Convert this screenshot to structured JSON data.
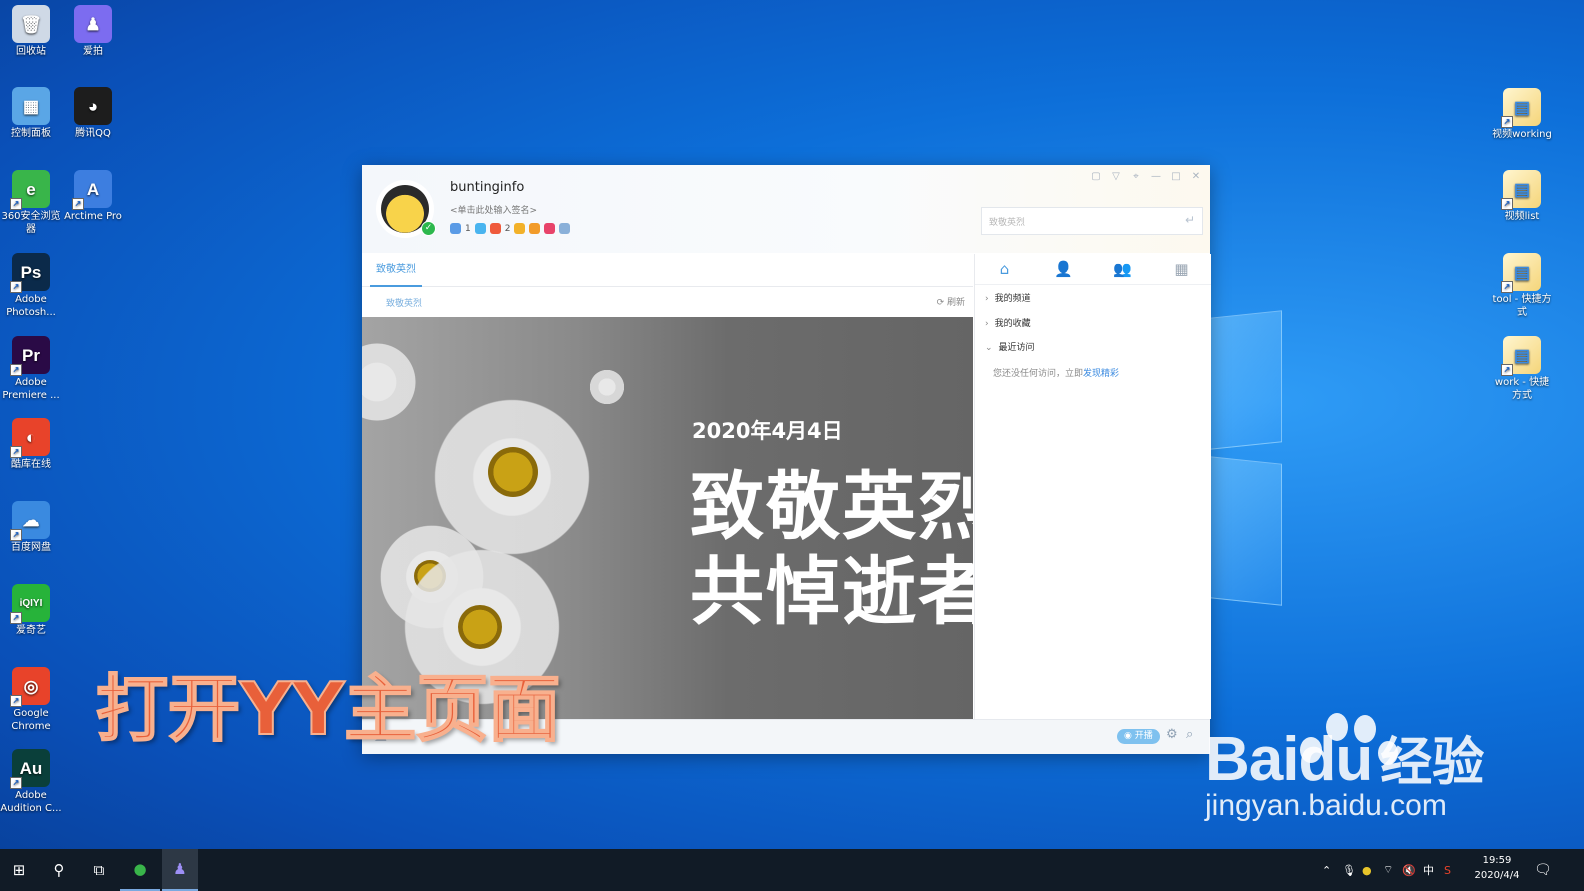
{
  "desktop": {
    "left_icons": [
      {
        "label": "回收站",
        "icon": "recycle-bin-icon",
        "glyph": "🗑",
        "color": "#cfd9e6"
      },
      {
        "label": "爱拍",
        "icon": "aipai-icon",
        "glyph": "♟",
        "color": "#7c6cf0"
      },
      {
        "label": "控制面板",
        "icon": "control-panel-icon",
        "glyph": "▦",
        "color": "#5aa6e6"
      },
      {
        "label": "腾讯QQ",
        "icon": "qq-icon",
        "glyph": "◕",
        "color": "#1d1d1d"
      },
      {
        "label": "360安全浏览器",
        "icon": "browser-360-icon",
        "glyph": "e",
        "color": "#39b54a"
      },
      {
        "label": "Arctime Pro",
        "icon": "arctime-icon",
        "glyph": "A",
        "color": "#3d7ee0"
      },
      {
        "label": "Adobe Photosh...",
        "icon": "photoshop-icon",
        "glyph": "Ps",
        "color": "#0b2a4a"
      },
      {
        "label": "Adobe Premiere ...",
        "icon": "premiere-icon",
        "glyph": "Pr",
        "color": "#2a0a46"
      },
      {
        "label": "酷库在线",
        "icon": "kuku-icon",
        "glyph": "◐",
        "color": "#e8432a"
      },
      {
        "label": "百度网盘",
        "icon": "baidu-netdisk-icon",
        "glyph": "☁",
        "color": "#3a8ae0"
      },
      {
        "label": "爱奇艺",
        "icon": "iqiyi-icon",
        "glyph": "iQIYI",
        "color": "#27b33a"
      },
      {
        "label": "Google Chrome",
        "icon": "chrome-icon",
        "glyph": "◎",
        "color": "#e8432a"
      },
      {
        "label": "Adobe Audition C...",
        "icon": "audition-icon",
        "glyph": "Au",
        "color": "#0a3f3a"
      }
    ],
    "right_icons": [
      {
        "label": "视频working",
        "icon": "folder-shortcut-icon"
      },
      {
        "label": "视频list",
        "icon": "folder-shortcut-icon"
      },
      {
        "label": "tool - 快捷方式",
        "icon": "folder-shortcut-icon"
      },
      {
        "label": "work - 快捷方式",
        "icon": "folder-shortcut-icon"
      }
    ]
  },
  "yy_window": {
    "username": "buntinginfo",
    "signature_placeholder": "<单击此处输入签名>",
    "badges": [
      {
        "icon": "vip-badge-icon",
        "count": "1",
        "color": "#5a9be6"
      },
      {
        "icon": "diamond-badge-icon",
        "count": "",
        "color": "#49b4ef"
      },
      {
        "icon": "level-badge-icon",
        "count": "2",
        "color": "#ef5a3c"
      },
      {
        "icon": "star-badge-icon",
        "count": "",
        "color": "#f2b12a"
      },
      {
        "icon": "smile-badge-icon",
        "count": "",
        "color": "#f29b2a"
      },
      {
        "icon": "heart-badge-icon",
        "count": "",
        "color": "#e8436a"
      },
      {
        "icon": "circle-badge-icon",
        "count": "",
        "color": "#8ab0d9"
      }
    ],
    "search_placeholder": "致敬英烈",
    "tab_active": "致敬英烈",
    "breadcrumb": "致敬英烈",
    "refresh_label": "刷新",
    "banner": {
      "date": "2020年4月4日",
      "line1": "致敬英烈",
      "line2": "共悼逝者"
    },
    "sidebar": {
      "items": [
        "我的频道",
        "我的收藏",
        "最近访问"
      ],
      "empty_note": "您还没任何访问，立即",
      "empty_link": "发现精彩"
    },
    "footer": {
      "live_button": "开播"
    }
  },
  "overlay_caption": "打开YY主页面",
  "watermark": {
    "brand": "Bai",
    "brand2": "du",
    "jingyan": "经验",
    "url": "jingyan.baidu.com"
  },
  "taskbar": {
    "time": "19:59",
    "date": "2020/4/4",
    "ime": "中"
  }
}
